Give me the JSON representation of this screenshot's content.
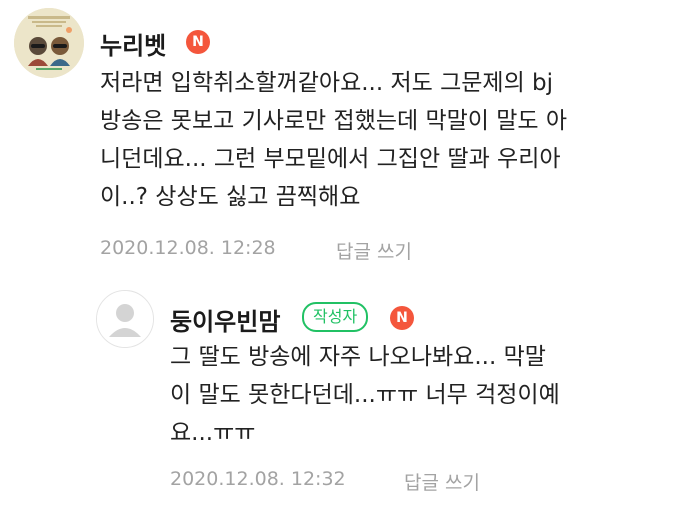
{
  "comments": [
    {
      "author": "누리벳",
      "badge": "N",
      "lines": [
        "저라면 입학취소할꺼같아요... 저도 그문제의 bj",
        "방송은 못보고 기사로만 접했는데 막말이 말도 아",
        "니던데요... 그런 부모밑에서 그집안 딸과 우리아",
        "이..? 상상도 싫고 끔찍해요"
      ],
      "date": "2020.12.08. 12:28",
      "reply_label": "답글 쓰기"
    },
    {
      "author": "둥이우빈맘",
      "writer_label": "작성자",
      "badge": "N",
      "lines": [
        "그 딸도 방송에 자주 나오나봐요... 막말",
        "이 말도 못한다던데...ㅠㅠ 너무 걱정이예",
        "요...ㅠㅠ"
      ],
      "date": "2020.12.08. 12:32",
      "reply_label": "답글 쓰기"
    }
  ],
  "icons": {
    "avatar_main": "profile-photo-icon",
    "avatar_reply": "default-profile-icon"
  },
  "colors": {
    "badge_n": "#f4563c",
    "writer_badge": "#21c164",
    "meta_text": "#a3a3a3"
  }
}
